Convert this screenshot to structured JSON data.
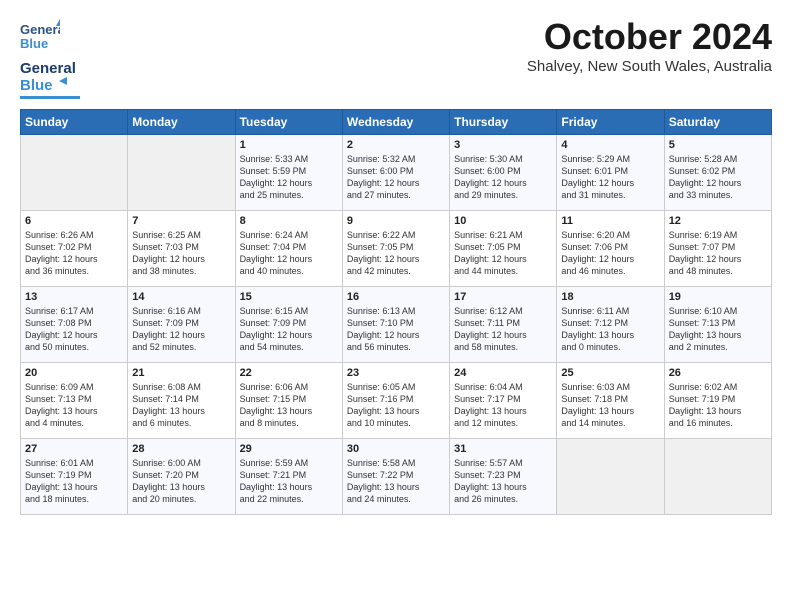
{
  "header": {
    "logo_general": "General",
    "logo_blue": "Blue",
    "month": "October 2024",
    "location": "Shalvey, New South Wales, Australia"
  },
  "weekdays": [
    "Sunday",
    "Monday",
    "Tuesday",
    "Wednesday",
    "Thursday",
    "Friday",
    "Saturday"
  ],
  "weeks": [
    [
      {
        "day": "",
        "content": ""
      },
      {
        "day": "",
        "content": ""
      },
      {
        "day": "1",
        "content": "Sunrise: 5:33 AM\nSunset: 5:59 PM\nDaylight: 12 hours\nand 25 minutes."
      },
      {
        "day": "2",
        "content": "Sunrise: 5:32 AM\nSunset: 6:00 PM\nDaylight: 12 hours\nand 27 minutes."
      },
      {
        "day": "3",
        "content": "Sunrise: 5:30 AM\nSunset: 6:00 PM\nDaylight: 12 hours\nand 29 minutes."
      },
      {
        "day": "4",
        "content": "Sunrise: 5:29 AM\nSunset: 6:01 PM\nDaylight: 12 hours\nand 31 minutes."
      },
      {
        "day": "5",
        "content": "Sunrise: 5:28 AM\nSunset: 6:02 PM\nDaylight: 12 hours\nand 33 minutes."
      }
    ],
    [
      {
        "day": "6",
        "content": "Sunrise: 6:26 AM\nSunset: 7:02 PM\nDaylight: 12 hours\nand 36 minutes."
      },
      {
        "day": "7",
        "content": "Sunrise: 6:25 AM\nSunset: 7:03 PM\nDaylight: 12 hours\nand 38 minutes."
      },
      {
        "day": "8",
        "content": "Sunrise: 6:24 AM\nSunset: 7:04 PM\nDaylight: 12 hours\nand 40 minutes."
      },
      {
        "day": "9",
        "content": "Sunrise: 6:22 AM\nSunset: 7:05 PM\nDaylight: 12 hours\nand 42 minutes."
      },
      {
        "day": "10",
        "content": "Sunrise: 6:21 AM\nSunset: 7:05 PM\nDaylight: 12 hours\nand 44 minutes."
      },
      {
        "day": "11",
        "content": "Sunrise: 6:20 AM\nSunset: 7:06 PM\nDaylight: 12 hours\nand 46 minutes."
      },
      {
        "day": "12",
        "content": "Sunrise: 6:19 AM\nSunset: 7:07 PM\nDaylight: 12 hours\nand 48 minutes."
      }
    ],
    [
      {
        "day": "13",
        "content": "Sunrise: 6:17 AM\nSunset: 7:08 PM\nDaylight: 12 hours\nand 50 minutes."
      },
      {
        "day": "14",
        "content": "Sunrise: 6:16 AM\nSunset: 7:09 PM\nDaylight: 12 hours\nand 52 minutes."
      },
      {
        "day": "15",
        "content": "Sunrise: 6:15 AM\nSunset: 7:09 PM\nDaylight: 12 hours\nand 54 minutes."
      },
      {
        "day": "16",
        "content": "Sunrise: 6:13 AM\nSunset: 7:10 PM\nDaylight: 12 hours\nand 56 minutes."
      },
      {
        "day": "17",
        "content": "Sunrise: 6:12 AM\nSunset: 7:11 PM\nDaylight: 12 hours\nand 58 minutes."
      },
      {
        "day": "18",
        "content": "Sunrise: 6:11 AM\nSunset: 7:12 PM\nDaylight: 13 hours\nand 0 minutes."
      },
      {
        "day": "19",
        "content": "Sunrise: 6:10 AM\nSunset: 7:13 PM\nDaylight: 13 hours\nand 2 minutes."
      }
    ],
    [
      {
        "day": "20",
        "content": "Sunrise: 6:09 AM\nSunset: 7:13 PM\nDaylight: 13 hours\nand 4 minutes."
      },
      {
        "day": "21",
        "content": "Sunrise: 6:08 AM\nSunset: 7:14 PM\nDaylight: 13 hours\nand 6 minutes."
      },
      {
        "day": "22",
        "content": "Sunrise: 6:06 AM\nSunset: 7:15 PM\nDaylight: 13 hours\nand 8 minutes."
      },
      {
        "day": "23",
        "content": "Sunrise: 6:05 AM\nSunset: 7:16 PM\nDaylight: 13 hours\nand 10 minutes."
      },
      {
        "day": "24",
        "content": "Sunrise: 6:04 AM\nSunset: 7:17 PM\nDaylight: 13 hours\nand 12 minutes."
      },
      {
        "day": "25",
        "content": "Sunrise: 6:03 AM\nSunset: 7:18 PM\nDaylight: 13 hours\nand 14 minutes."
      },
      {
        "day": "26",
        "content": "Sunrise: 6:02 AM\nSunset: 7:19 PM\nDaylight: 13 hours\nand 16 minutes."
      }
    ],
    [
      {
        "day": "27",
        "content": "Sunrise: 6:01 AM\nSunset: 7:19 PM\nDaylight: 13 hours\nand 18 minutes."
      },
      {
        "day": "28",
        "content": "Sunrise: 6:00 AM\nSunset: 7:20 PM\nDaylight: 13 hours\nand 20 minutes."
      },
      {
        "day": "29",
        "content": "Sunrise: 5:59 AM\nSunset: 7:21 PM\nDaylight: 13 hours\nand 22 minutes."
      },
      {
        "day": "30",
        "content": "Sunrise: 5:58 AM\nSunset: 7:22 PM\nDaylight: 13 hours\nand 24 minutes."
      },
      {
        "day": "31",
        "content": "Sunrise: 5:57 AM\nSunset: 7:23 PM\nDaylight: 13 hours\nand 26 minutes."
      },
      {
        "day": "",
        "content": ""
      },
      {
        "day": "",
        "content": ""
      }
    ]
  ]
}
